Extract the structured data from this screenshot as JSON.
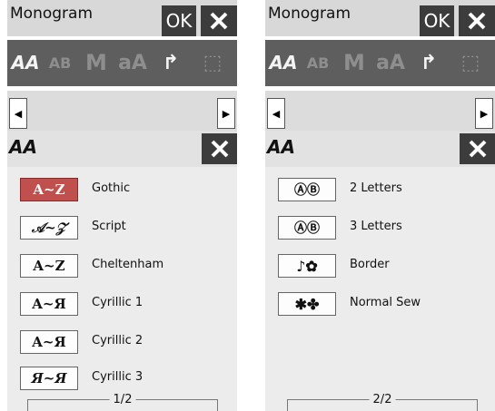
{
  "panels": [
    {
      "title": "Monogram",
      "ok_label": "OK",
      "toolbar": [
        "AA",
        "AB",
        "M",
        "aA",
        "↱",
        "⬚"
      ],
      "list_header_icon": "AA",
      "items": [
        {
          "glyph": "A~Z",
          "label": "Gothic",
          "selected": true
        },
        {
          "glyph": "𝒜~𝒵",
          "label": "Script",
          "selected": false
        },
        {
          "glyph": "A~Z",
          "label": "Cheltenham",
          "selected": false
        },
        {
          "glyph": "A~Я",
          "label": "Cyrillic 1",
          "selected": false
        },
        {
          "glyph": "A~Я",
          "label": "Cyrillic 2",
          "selected": false
        },
        {
          "glyph": "Я~Я",
          "label": "Cyrillic 3",
          "selected": false
        }
      ],
      "page_indicator": "1/2"
    },
    {
      "title": "Monogram",
      "ok_label": "OK",
      "toolbar": [
        "AA",
        "AB",
        "M",
        "aA",
        "↱",
        "⬚"
      ],
      "list_header_icon": "AA",
      "items": [
        {
          "glyph": "ⒶⒷ",
          "label": "2 Letters",
          "selected": false
        },
        {
          "glyph": "ⒶⒷ",
          "label": "3 Letters",
          "selected": false
        },
        {
          "glyph": "♪✿",
          "label": "Border",
          "selected": false
        },
        {
          "glyph": "✱✤",
          "label": "Normal Sew",
          "selected": false
        }
      ],
      "page_indicator": "2/2"
    }
  ],
  "colors": {
    "selected": "#c0504d",
    "dark_button": "#3c3c3c",
    "toolbar": "#5e5e5e"
  }
}
